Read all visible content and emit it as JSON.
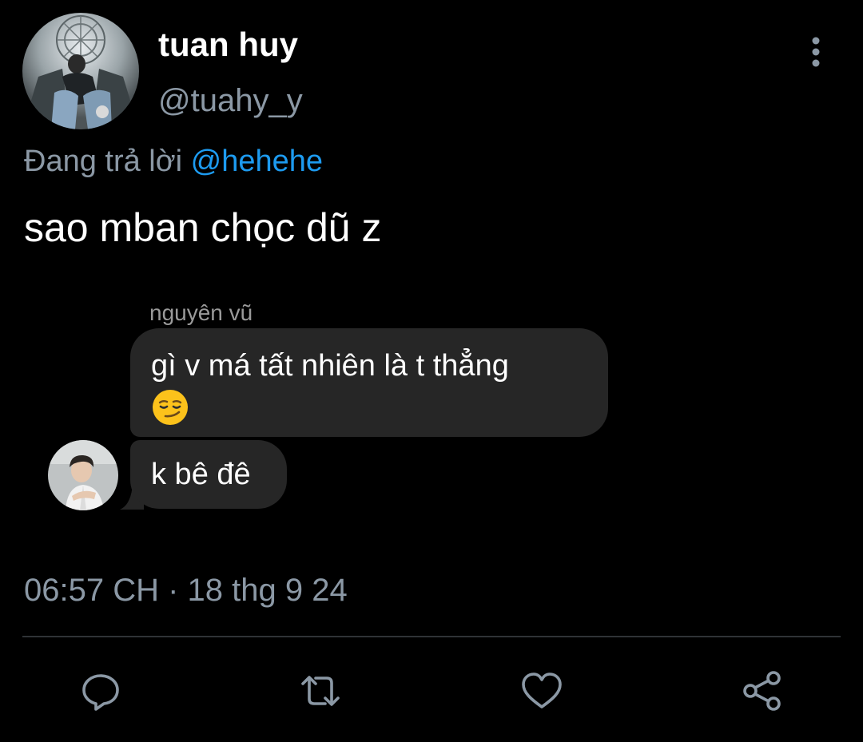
{
  "tweet": {
    "author": {
      "display_name": "tuan huy",
      "handle": "@tuahy_y",
      "avatar_icon": "profile-photo"
    },
    "reply_prefix": "Đang trả lời",
    "reply_to": "@hehehe",
    "text": "sao mban chọc dũ z",
    "timestamp": "06:57 CH · 18 thg 9 24"
  },
  "embedded_chat": {
    "sender_name": "nguyên vũ",
    "messages": [
      {
        "text": "gì v má tất nhiên là t thẳng",
        "emoji": "smirking-face"
      },
      {
        "text": "k bê đê"
      }
    ],
    "avatar_icon": "chat-profile-photo",
    "bubble_color": "#262626"
  },
  "actions": [
    {
      "name": "reply",
      "icon": "reply-icon"
    },
    {
      "name": "retweet",
      "icon": "retweet-icon"
    },
    {
      "name": "like",
      "icon": "heart-icon"
    },
    {
      "name": "share",
      "icon": "share-icon"
    }
  ],
  "colors": {
    "background": "#000000",
    "primary_text": "#ffffff",
    "secondary_text": "#8b98a5",
    "accent": "#1d9bf0",
    "divider": "#2f3336"
  }
}
